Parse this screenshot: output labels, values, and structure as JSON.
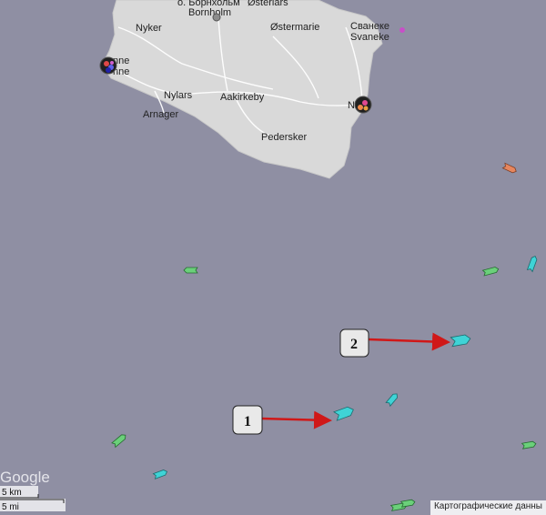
{
  "map": {
    "places": {
      "bornholm_ru": "о. Борнхольм",
      "bornholm": "Bornholm",
      "osterlars": "Østerlars",
      "nyker": "Nyker",
      "ostermarie": "Østermarie",
      "svaneke_ru": "Сванеке",
      "svaneke": "Svaneke",
      "ronne_a": "nne",
      "ronne_b": "nne",
      "nylars": "Nylars",
      "aakirkeby": "Aakirkeby",
      "arnager": "Arnager",
      "nexo": "N",
      "pedersker": "Pedersker"
    },
    "callouts": [
      {
        "label": "1"
      },
      {
        "label": "2"
      }
    ],
    "google_logo": "Google",
    "scale": {
      "km": "5 km",
      "mi": "5 mi"
    },
    "attribution": "Картографические данны",
    "colors": {
      "sea": "#8f8fa3",
      "land": "#d9d9d9",
      "vessel_cyan": "#3fd3d6",
      "vessel_green": "#6bd07a",
      "vessel_orange": "#e7865e",
      "arrow": "#d01818"
    }
  }
}
